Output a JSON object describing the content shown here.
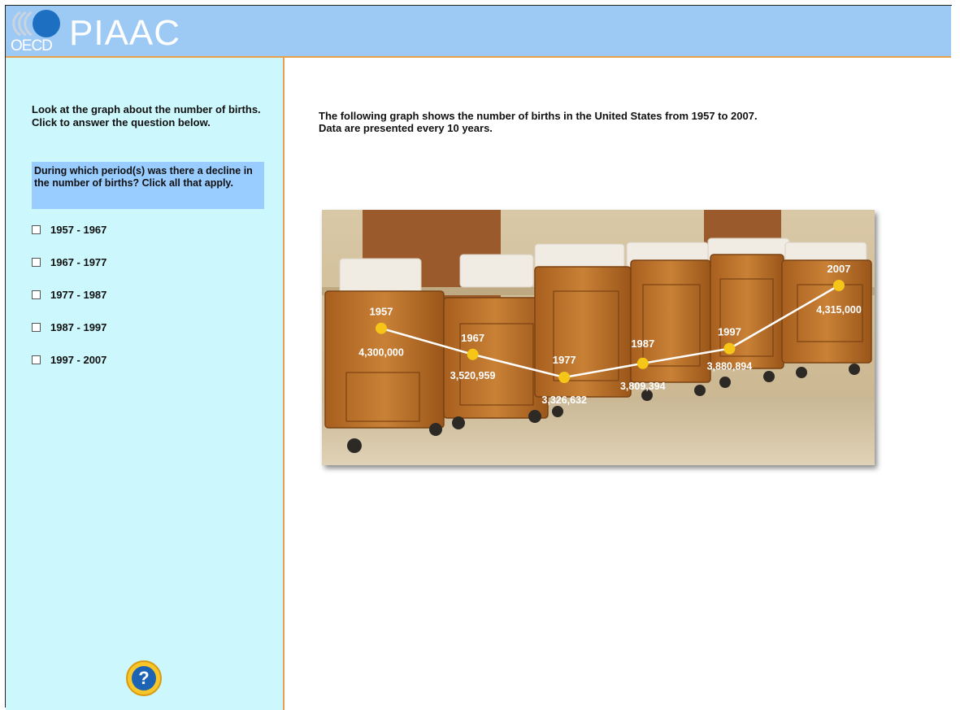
{
  "header": {
    "logo_text": "OECD",
    "title": "PIAAC",
    "logo_icon": "oecd-logo"
  },
  "sidebar": {
    "instructions": "Look at the graph about the number of births. Click to answer the question below.",
    "question": "During which period(s) was there a decline in the number of births? Click all that apply.",
    "options": [
      {
        "label": "1957 - 1967",
        "checked": false
      },
      {
        "label": "1967 - 1977",
        "checked": false
      },
      {
        "label": "1977 - 1987",
        "checked": false
      },
      {
        "label": "1987 - 1997",
        "checked": false
      },
      {
        "label": "1997 - 2007",
        "checked": false
      }
    ],
    "help_icon": "question-mark-icon",
    "help_label": "?"
  },
  "main": {
    "description_line1": "The following graph shows the number of births in the United States from 1957 to 2007.",
    "description_line2": "Data are presented every 10 years."
  },
  "colors": {
    "header_bg": "#9dc9f5",
    "sidebar_bg": "#ccf7fc",
    "question_bg": "#99ccff",
    "border_accent": "#e8a04a",
    "point_color": "#f5c518",
    "line_color": "#ffffff"
  },
  "chart_data": {
    "type": "line",
    "background": "photo of hospital newborn bassinets",
    "x": [
      "1957",
      "1967",
      "1977",
      "1987",
      "1997",
      "2007"
    ],
    "values": [
      4300000,
      3520959,
      3326632,
      3809394,
      3880894,
      4315000
    ],
    "value_labels": [
      "4,300,000",
      "3,520,959",
      "3,326,632",
      "3,809,394",
      "3,880,894",
      "4,315,000"
    ],
    "title": "",
    "xlabel": "",
    "ylabel": "",
    "grid": false,
    "legend": "none"
  }
}
